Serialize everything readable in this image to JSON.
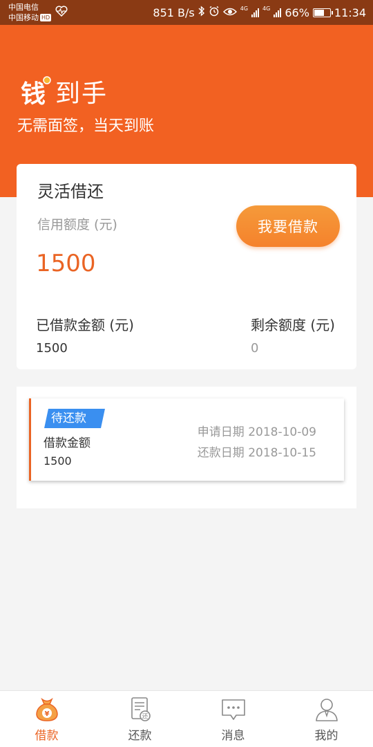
{
  "status_bar": {
    "carrier1": "中国电信",
    "carrier2": "中国移动",
    "hd": "HD",
    "net_speed": "851 B/s",
    "net1": "4G",
    "net2": "4G",
    "battery_percent": "66%",
    "battery_level": 0.66,
    "time": "11:34"
  },
  "header": {
    "app_name": "到手",
    "logo_char": "钱",
    "slogan": "无需面签，当天到账"
  },
  "credit_card": {
    "title": "灵活借还",
    "credit_label": "信用额度 (元)",
    "credit_amount": "1500",
    "borrow_button": "我要借款",
    "borrowed_label": "已借款金额 (元)",
    "borrowed_value": "1500",
    "remaining_label": "剩余额度 (元)",
    "remaining_value": "0"
  },
  "loans": [
    {
      "status": "待还款",
      "amount_label": "借款金额",
      "amount": "1500",
      "apply_date": "申请日期 2018-10-09",
      "repay_date": "还款日期 2018-10-15"
    }
  ],
  "nav": {
    "items": [
      {
        "label": "借款",
        "icon": "money-bag-icon",
        "active": true
      },
      {
        "label": "还款",
        "icon": "repay-document-icon",
        "active": false
      },
      {
        "label": "消息",
        "icon": "message-icon",
        "active": false
      },
      {
        "label": "我的",
        "icon": "profile-icon",
        "active": false
      }
    ]
  },
  "colors": {
    "brand": "#f26122",
    "accent_text": "#ea6424",
    "tag_blue": "#3a8ff0"
  }
}
